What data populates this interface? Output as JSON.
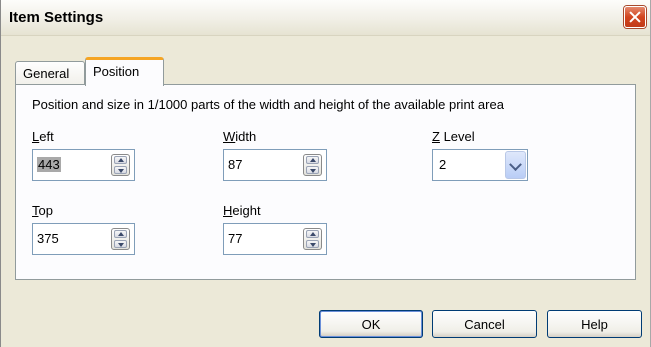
{
  "window": {
    "title": "Item Settings"
  },
  "tabs": [
    {
      "label": "General",
      "active": false
    },
    {
      "label": "Position",
      "active": true
    }
  ],
  "panel": {
    "description": "Position and size in 1/1000 parts of the width and height of the available print area",
    "fields": {
      "left": {
        "label_mnemonic": "L",
        "label_rest": "eft",
        "value": "443"
      },
      "width": {
        "label_mnemonic": "W",
        "label_rest": "idth",
        "value": "87"
      },
      "top": {
        "label_mnemonic": "T",
        "label_rest": "op",
        "value": "375"
      },
      "height": {
        "label_mnemonic": "H",
        "label_rest": "eight",
        "value": "77"
      }
    },
    "z_level": {
      "label_mnemonic": "Z",
      "label_rest": " Level",
      "value": "2"
    }
  },
  "buttons": {
    "ok": "OK",
    "cancel": "Cancel",
    "help": "Help"
  }
}
